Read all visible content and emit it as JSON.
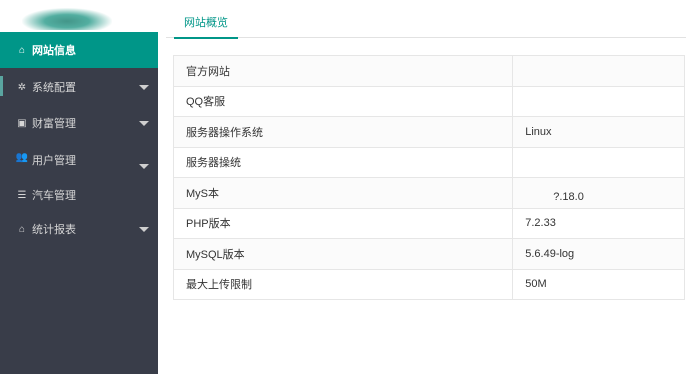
{
  "sidebar": {
    "items": [
      {
        "label": "网站信息",
        "icon": "home-icon",
        "glyph": "⌂"
      },
      {
        "label": "系统配置",
        "icon": "gears-icon",
        "glyph": "✲"
      },
      {
        "label": "财富管理",
        "icon": "money-icon",
        "glyph": "▣"
      },
      {
        "label": "用户管理",
        "icon": "users-icon",
        "glyph": "👥"
      },
      {
        "label": "汽车管理",
        "icon": "list-icon",
        "glyph": "☰"
      },
      {
        "label": "统计报表",
        "icon": "home-icon",
        "glyph": "⌂"
      }
    ]
  },
  "main": {
    "tab": "网站概览",
    "rows": [
      {
        "key": "官方网站",
        "value": ""
      },
      {
        "key": "QQ客服",
        "value": ""
      },
      {
        "key": "服务器操作系统",
        "value": "Linux"
      },
      {
        "key": "服务器操统",
        "value": ""
      },
      {
        "key": "MyS本",
        "value": "?.18.0"
      },
      {
        "key": "PHP版本",
        "value": "7.2.33"
      },
      {
        "key": "MySQL版本",
        "value": "5.6.49-log"
      },
      {
        "key": "最大上传限制",
        "value": "50M"
      }
    ]
  },
  "colors": {
    "sidebar_bg": "#393d49",
    "accent": "#009688"
  }
}
